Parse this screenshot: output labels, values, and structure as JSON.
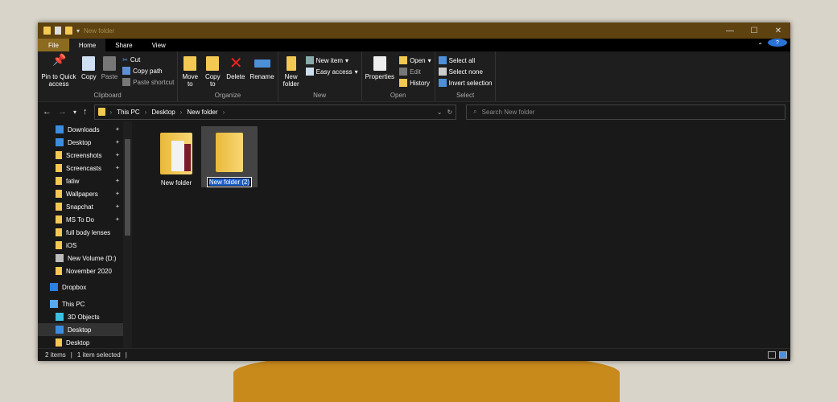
{
  "title": "New folder",
  "tabs": [
    "File",
    "Home",
    "Share",
    "View"
  ],
  "ribbon": {
    "clipboard": {
      "label": "Clipboard",
      "pin": "Pin to Quick access",
      "copy": "Copy",
      "paste": "Paste",
      "cut": "Cut",
      "copy_path": "Copy path",
      "paste_shortcut": "Paste shortcut"
    },
    "organize": {
      "label": "Organize",
      "move_to": "Move to",
      "copy_to": "Copy to",
      "delete": "Delete",
      "rename": "Rename"
    },
    "new": {
      "label": "New",
      "new_folder": "New folder",
      "new_item": "New item",
      "easy_access": "Easy access"
    },
    "open": {
      "label": "Open",
      "properties": "Properties",
      "open": "Open",
      "edit": "Edit",
      "history": "History"
    },
    "select": {
      "label": "Select",
      "select_all": "Select all",
      "select_none": "Select none",
      "invert": "Invert selection"
    }
  },
  "breadcrumb": [
    "This PC",
    "Desktop",
    "New folder"
  ],
  "search_placeholder": "Search New folder",
  "sidebar": [
    {
      "label": "Downloads",
      "icon": "download-icon",
      "pinned": true
    },
    {
      "label": "Desktop",
      "icon": "desktop-icon",
      "pinned": true
    },
    {
      "label": "Screenshots",
      "icon": "folder-icon",
      "pinned": true
    },
    {
      "label": "Screencasts",
      "icon": "folder-icon",
      "pinned": true
    },
    {
      "label": "fatiw",
      "icon": "folder-icon",
      "pinned": true
    },
    {
      "label": "Wallpapers",
      "icon": "folder-icon",
      "pinned": true
    },
    {
      "label": "Snapchat",
      "icon": "folder-icon",
      "pinned": true
    },
    {
      "label": "MS To Do",
      "icon": "folder-icon",
      "pinned": true
    },
    {
      "label": "full body lenses",
      "icon": "folder-icon"
    },
    {
      "label": "iOS",
      "icon": "folder-icon"
    },
    {
      "label": "New Volume (D:)",
      "icon": "drive-icon"
    },
    {
      "label": "November 2020",
      "icon": "folder-icon"
    },
    {
      "label": "Dropbox",
      "icon": "dropbox-icon"
    },
    {
      "label": "This PC",
      "icon": "pc-icon"
    },
    {
      "label": "3D Objects",
      "icon": "cube-icon"
    },
    {
      "label": "Desktop",
      "icon": "desktop-icon",
      "selected": true
    },
    {
      "label": "Desktop",
      "icon": "folder-icon"
    }
  ],
  "files": [
    {
      "name": "New folder"
    },
    {
      "name": "New folder (2)",
      "renaming": true
    }
  ],
  "status": {
    "count": "2 items",
    "selected": "1 item selected"
  }
}
